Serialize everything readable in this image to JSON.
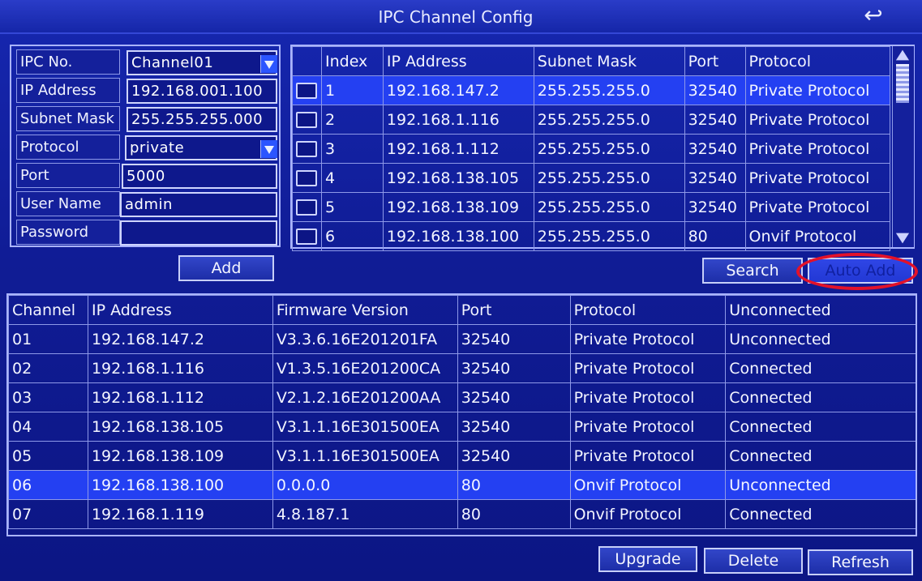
{
  "window": {
    "title": "IPC Channel Config",
    "back_icon": "return-arrow-icon"
  },
  "form": {
    "labels": {
      "ipc_no": "IPC No.",
      "ip": "IP Address",
      "mask": "Subnet Mask",
      "protocol": "Protocol",
      "port": "Port",
      "user": "User Name",
      "password": "Password"
    },
    "values": {
      "ipc_no": "Channel01",
      "ip": "192.168.001.100",
      "mask": "255.255.255.000",
      "protocol": "private",
      "port": "5000",
      "user": "admin",
      "password": ""
    },
    "add_label": "Add"
  },
  "search_table": {
    "headers": {
      "index": "Index",
      "ip": "IP Address",
      "mask": "Subnet Mask",
      "port": "Port",
      "protocol": "Protocol"
    },
    "rows": [
      {
        "index": "1",
        "ip": "192.168.147.2",
        "mask": "255.255.255.0",
        "port": "32540",
        "protocol": "Private Protocol"
      },
      {
        "index": "2",
        "ip": "192.168.1.116",
        "mask": "255.255.255.0",
        "port": "32540",
        "protocol": "Private Protocol"
      },
      {
        "index": "3",
        "ip": "192.168.1.112",
        "mask": "255.255.255.0",
        "port": "32540",
        "protocol": "Private Protocol"
      },
      {
        "index": "4",
        "ip": "192.168.138.105",
        "mask": "255.255.255.0",
        "port": "32540",
        "protocol": "Private Protocol"
      },
      {
        "index": "5",
        "ip": "192.168.138.109",
        "mask": "255.255.255.0",
        "port": "32540",
        "protocol": "Private Protocol"
      },
      {
        "index": "6",
        "ip": "192.168.138.100",
        "mask": "255.255.255.0",
        "port": "80",
        "protocol": "Onvif Protocol"
      }
    ],
    "search_label": "Search",
    "auto_add_label": "Auto Add"
  },
  "channel_table": {
    "headers": {
      "channel": "Channel",
      "ip": "IP Address",
      "fw": "Firmware Version",
      "port": "Port",
      "protocol": "Protocol",
      "status": "Unconnected"
    },
    "rows": [
      {
        "channel": "01",
        "ip": "192.168.147.2",
        "fw": "V3.3.6.16E201201FA",
        "port": "32540",
        "protocol": "Private Protocol",
        "status": "Unconnected"
      },
      {
        "channel": "02",
        "ip": "192.168.1.116",
        "fw": "V1.3.5.16E201200CA",
        "port": "32540",
        "protocol": "Private Protocol",
        "status": "Connected"
      },
      {
        "channel": "03",
        "ip": "192.168.1.112",
        "fw": "V2.1.2.16E201200AA",
        "port": "32540",
        "protocol": "Private Protocol",
        "status": "Connected"
      },
      {
        "channel": "04",
        "ip": "192.168.138.105",
        "fw": "V3.1.1.16E301500EA",
        "port": "32540",
        "protocol": "Private Protocol",
        "status": "Connected"
      },
      {
        "channel": "05",
        "ip": "192.168.138.109",
        "fw": "V3.1.1.16E301500EA",
        "port": "32540",
        "protocol": "Private Protocol",
        "status": "Connected"
      },
      {
        "channel": "06",
        "ip": "192.168.138.100",
        "fw": "0.0.0.0",
        "port": "80",
        "protocol": "Onvif Protocol",
        "status": "Unconnected"
      },
      {
        "channel": "07",
        "ip": "192.168.1.119",
        "fw": "4.8.187.1",
        "port": "80",
        "protocol": "Onvif Protocol",
        "status": "Connected"
      }
    ]
  },
  "footer": {
    "upgrade_label": "Upgrade",
    "delete_label": "Delete",
    "refresh_label": "Refresh"
  },
  "colors": {
    "background": "#101c95",
    "selection": "#2440f2",
    "highlight_ring": "#e3122a"
  }
}
